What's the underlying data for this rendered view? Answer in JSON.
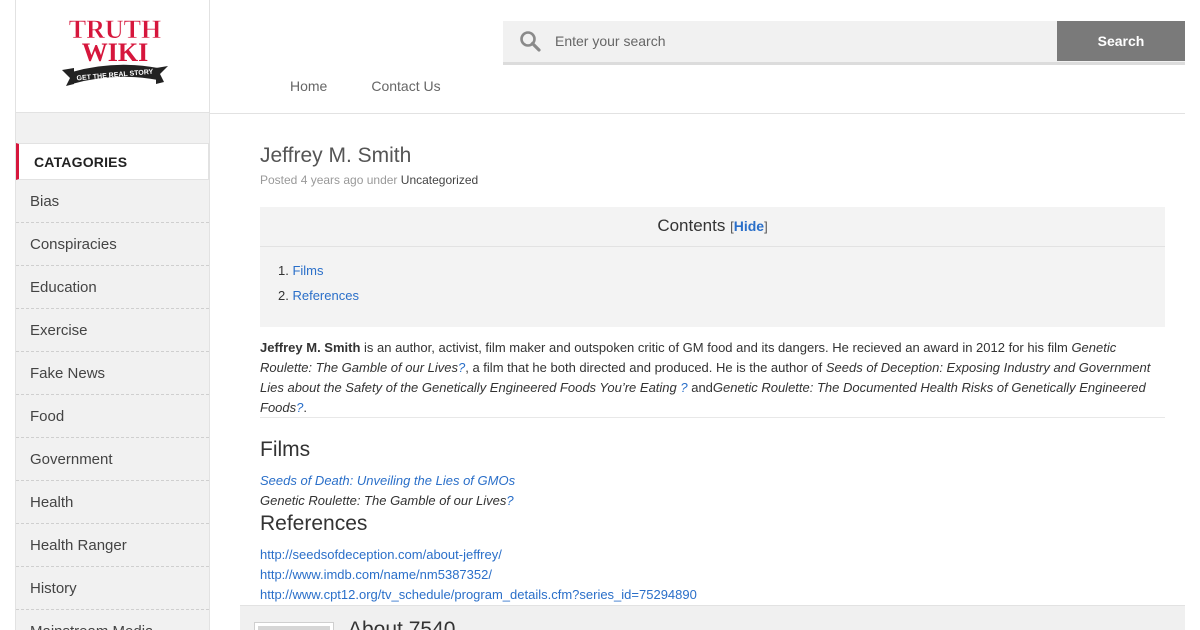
{
  "logo": {
    "line1": "TRUTH",
    "line2": "WIKI",
    "tagline": "GET THE REAL STORY"
  },
  "search": {
    "placeholder": "Enter your search",
    "button_label": "Search"
  },
  "nav": [
    "Home",
    "Contact Us"
  ],
  "sidebar": {
    "title": "CATAGORIES",
    "items": [
      "Bias",
      "Conspiracies",
      "Education",
      "Exercise",
      "Fake News",
      "Food",
      "Government",
      "Health",
      "Health Ranger",
      "History",
      "Mainstream Media"
    ]
  },
  "post": {
    "title": "Jeffrey M. Smith",
    "meta_prefix": "Posted 4 years ago under",
    "category": "Uncategorized"
  },
  "toc": {
    "title": "Contents",
    "open_bracket": "[",
    "hide_label": "Hide",
    "close_bracket": "]",
    "items": [
      {
        "num": "1.",
        "label": "Films"
      },
      {
        "num": "2.",
        "label": "References"
      }
    ]
  },
  "intro": {
    "name": "Jeffrey M. Smith",
    "text1": " is an author, activist, film maker and outspoken critic of GM food and its dangers. He recieved an award in 2012 for his film ",
    "film": "Genetic Roulette: The Gamble of our Lives",
    "q1": "?",
    "text2": ", a film that he both directed and produced. He is the author of ",
    "book1": "Seeds of Deception: Exposing Industry and Government Lies about the Safety of the Genetically Engineered Foods You’re Eating",
    "q2": " ?",
    "text3": " and",
    "book2": "Genetic Roulette: The Documented Health Risks of Genetically Engineered Foods",
    "q3": "?",
    "end": "."
  },
  "films": {
    "heading": "Films",
    "item1": "Seeds of Death: Unveiling the Lies of GMOs",
    "item2": "Genetic Roulette: The Gamble of our Lives",
    "item2_q": "?"
  },
  "references": {
    "heading": "References",
    "links": [
      "http://seedsofdeception.com/about-jeffrey/",
      "http://www.imdb.com/name/nm5387352/",
      "http://www.cpt12.org/tv_schedule/program_details.cfm?series_id=75294890"
    ]
  },
  "author_box": {
    "title": "About 7540"
  },
  "colors": {
    "accent": "#d6163c",
    "link": "#2a6fc9",
    "button": "#7a7a7a"
  }
}
